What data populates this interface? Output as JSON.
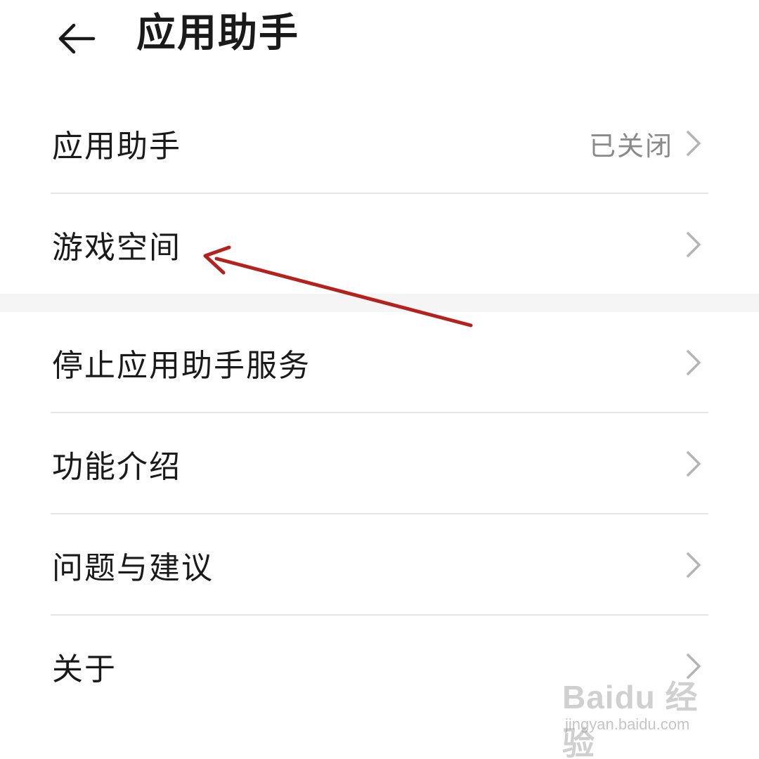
{
  "header": {
    "title": "应用助手",
    "back_icon": "arrow-left-icon"
  },
  "section1": {
    "items": [
      {
        "label": "应用助手",
        "value": "已关闭"
      },
      {
        "label": "游戏空间",
        "value": ""
      }
    ]
  },
  "section2": {
    "items": [
      {
        "label": "停止应用助手服务"
      },
      {
        "label": "功能介绍"
      },
      {
        "label": "问题与建议"
      },
      {
        "label": "关于"
      }
    ]
  },
  "watermark": {
    "brand": "Baidu 经验",
    "url": "jingyan.baidu.com"
  },
  "colors": {
    "text": "#1a1a1a",
    "secondary": "#8a8a8a",
    "chevron": "#b3b3b3",
    "divider": "#e6e6e6",
    "annotation_arrow": "#b5211d"
  }
}
